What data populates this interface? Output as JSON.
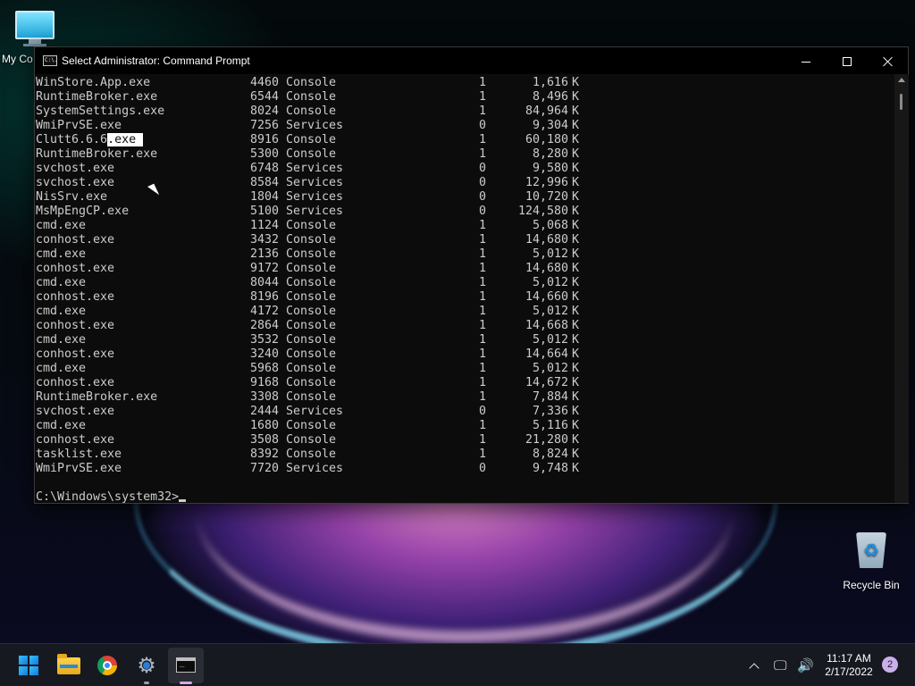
{
  "desktop": {
    "icons": [
      {
        "label": "My Co"
      },
      {
        "label": "Recycle Bin"
      }
    ]
  },
  "window": {
    "title": "Select Administrator: Command Prompt",
    "icon_text": "C:\\.",
    "selected_text": ".exe"
  },
  "console": {
    "rows": [
      [
        "WinStore.App.exe",
        "4460",
        "Console",
        "1",
        "1,616",
        "K"
      ],
      [
        "RuntimeBroker.exe",
        "6544",
        "Console",
        "1",
        "8,496",
        "K"
      ],
      [
        "SystemSettings.exe",
        "8024",
        "Console",
        "1",
        "84,964",
        "K"
      ],
      [
        "WmiPrvSE.exe",
        "7256",
        "Services",
        "0",
        "9,304",
        "K"
      ],
      [
        "Clutt6.6.6",
        "8916",
        "Console",
        "1",
        "60,180",
        "K"
      ],
      [
        "RuntimeBroker.exe",
        "5300",
        "Console",
        "1",
        "8,280",
        "K"
      ],
      [
        "svchost.exe",
        "6748",
        "Services",
        "0",
        "9,580",
        "K"
      ],
      [
        "svchost.exe",
        "8584",
        "Services",
        "0",
        "12,996",
        "K"
      ],
      [
        "NisSrv.exe",
        "1804",
        "Services",
        "0",
        "10,720",
        "K"
      ],
      [
        "MsMpEngCP.exe",
        "5100",
        "Services",
        "0",
        "124,580",
        "K"
      ],
      [
        "cmd.exe",
        "1124",
        "Console",
        "1",
        "5,068",
        "K"
      ],
      [
        "conhost.exe",
        "3432",
        "Console",
        "1",
        "14,680",
        "K"
      ],
      [
        "cmd.exe",
        "2136",
        "Console",
        "1",
        "5,012",
        "K"
      ],
      [
        "conhost.exe",
        "9172",
        "Console",
        "1",
        "14,680",
        "K"
      ],
      [
        "cmd.exe",
        "8044",
        "Console",
        "1",
        "5,012",
        "K"
      ],
      [
        "conhost.exe",
        "8196",
        "Console",
        "1",
        "14,660",
        "K"
      ],
      [
        "cmd.exe",
        "4172",
        "Console",
        "1",
        "5,012",
        "K"
      ],
      [
        "conhost.exe",
        "2864",
        "Console",
        "1",
        "14,668",
        "K"
      ],
      [
        "cmd.exe",
        "3532",
        "Console",
        "1",
        "5,012",
        "K"
      ],
      [
        "conhost.exe",
        "3240",
        "Console",
        "1",
        "14,664",
        "K"
      ],
      [
        "cmd.exe",
        "5968",
        "Console",
        "1",
        "5,012",
        "K"
      ],
      [
        "conhost.exe",
        "9168",
        "Console",
        "1",
        "14,672",
        "K"
      ],
      [
        "RuntimeBroker.exe",
        "3308",
        "Console",
        "1",
        "7,884",
        "K"
      ],
      [
        "svchost.exe",
        "2444",
        "Services",
        "0",
        "7,336",
        "K"
      ],
      [
        "cmd.exe",
        "1680",
        "Console",
        "1",
        "5,116",
        "K"
      ],
      [
        "conhost.exe",
        "3508",
        "Console",
        "1",
        "21,280",
        "K"
      ],
      [
        "tasklist.exe",
        "8392",
        "Console",
        "1",
        "8,824",
        "K"
      ],
      [
        "WmiPrvSE.exe",
        "7720",
        "Services",
        "0",
        "9,748",
        "K"
      ]
    ],
    "prompt": "C:\\Windows\\system32>"
  },
  "taskbar": {
    "apps": [
      "start-icon",
      "file-explorer-icon",
      "chrome-icon",
      "settings-icon",
      "command-prompt-icon"
    ],
    "clock_time": "11:17 AM",
    "clock_date": "2/17/2022",
    "notification_count": "2",
    "tray_network": "🖵",
    "tray_volume": "🔊"
  },
  "colors": {
    "console_bg": "#0c0c0c",
    "console_text": "#cccccc",
    "start_blue": "#1379d8",
    "notification_badge": "#c9b0ec"
  }
}
